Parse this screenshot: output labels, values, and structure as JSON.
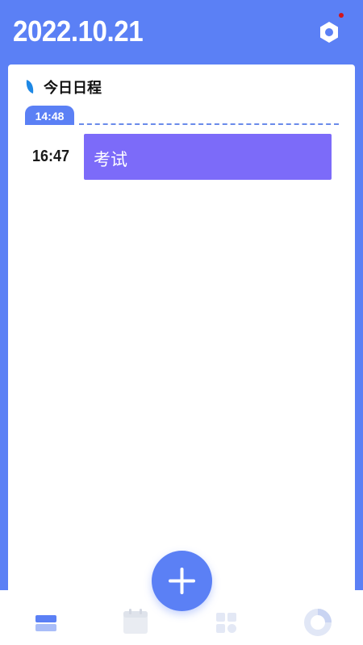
{
  "header": {
    "date": "2022.10.21",
    "settings_icon": "hexagon-settings-icon",
    "notification_dot_color": "#d2141b"
  },
  "schedule": {
    "section_title": "今日日程",
    "current_time": "14:48",
    "events": [
      {
        "time": "16:47",
        "title": "考试",
        "color": "#7c6bf9"
      }
    ]
  },
  "tabbar": {
    "tabs": [
      {
        "icon": "list-icon",
        "active": true
      },
      {
        "icon": "calendar-icon",
        "active": false
      },
      {
        "icon": "widgets-icon",
        "active": false
      },
      {
        "icon": "donut-chart-icon",
        "active": false
      }
    ],
    "add_icon": "plus-icon"
  },
  "colors": {
    "accent": "#5b80f5",
    "event": "#7c6bf9"
  }
}
